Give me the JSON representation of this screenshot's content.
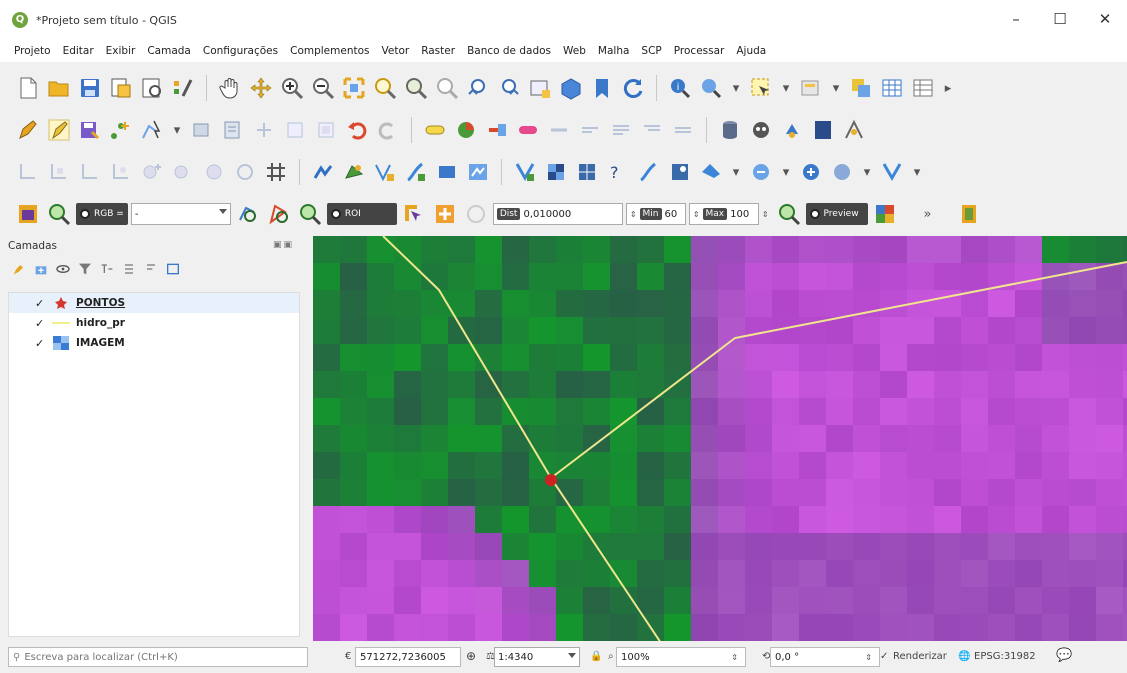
{
  "window": {
    "title": "*Projeto sem título - QGIS",
    "app_icon": "qgis-logo-icon",
    "controls": [
      "minimize-icon",
      "maximize-icon",
      "close-icon"
    ]
  },
  "menu": [
    "Projeto",
    "Editar",
    "Exibir",
    "Camada",
    "Configurações",
    "Complementos",
    "Vetor",
    "Raster",
    "Banco de dados",
    "Web",
    "Malha",
    "SCP",
    "Processar",
    "Ajuda"
  ],
  "scp_toolbar": {
    "rgb_label": "RGB =",
    "rgb_value": "-",
    "roi_label": "ROI",
    "dist_label": "Dist",
    "dist_value": "0,010000",
    "min_label": "Min",
    "min_value": "60",
    "max_label": "Max",
    "max_value": "100",
    "preview_label": "Preview",
    "overflow": "»"
  },
  "layers_panel": {
    "title": "Camadas",
    "layers": [
      {
        "name": "PONTOS",
        "checked": "✓",
        "symbol": "point-marker-icon",
        "color": "#d4372c"
      },
      {
        "name": "hidro_pr",
        "checked": "✓",
        "symbol": "line-symbol-icon",
        "color": "#f2f08a"
      },
      {
        "name": "IMAGEM",
        "checked": "✓",
        "symbol": "raster-icon",
        "color": "#3a7bd5"
      }
    ]
  },
  "statusbar": {
    "locator_placeholder": "Escreva para localizar (Ctrl+K)",
    "coord_label": "€",
    "coordinate": "571272,7236005",
    "scale_label": "Escala",
    "scale": "1:4340",
    "magnifier_label": "Lupa",
    "magnifier": "100%",
    "rotation_label": "Rotação",
    "rotation": "0,0 °",
    "render_checked": "✓",
    "render_label": "Renderizar",
    "crs": "EPSG:31982"
  },
  "map": {
    "line_color": "#f0e68c",
    "point_color": "#cc2222"
  }
}
